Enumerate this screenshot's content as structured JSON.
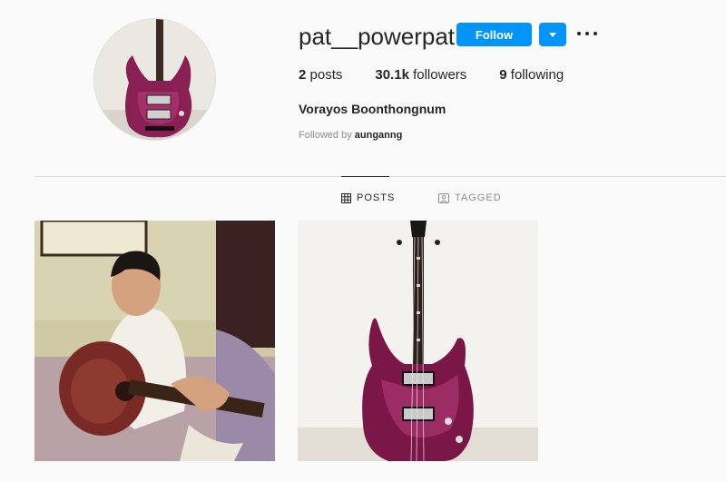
{
  "profile": {
    "username": "pat__powerpat",
    "follow_label": "Follow",
    "stats": {
      "posts_count": "2",
      "posts_label": "posts",
      "followers_count": "30.1k",
      "followers_label": "followers",
      "following_count": "9",
      "following_label": "following"
    },
    "full_name": "Vorayos Boonthongnum",
    "followed_by_prefix": "Followed by",
    "followed_by_user": "aunganng"
  },
  "tabs": [
    {
      "label": "POSTS",
      "icon": "grid-icon",
      "active": true
    },
    {
      "label": "TAGGED",
      "icon": "tag-person-icon",
      "active": false
    }
  ],
  "colors": {
    "accent": "#0095f6",
    "text": "#262626",
    "muted": "#8e8e8e",
    "divider": "#dbdbdb",
    "background": "#fafafa"
  }
}
